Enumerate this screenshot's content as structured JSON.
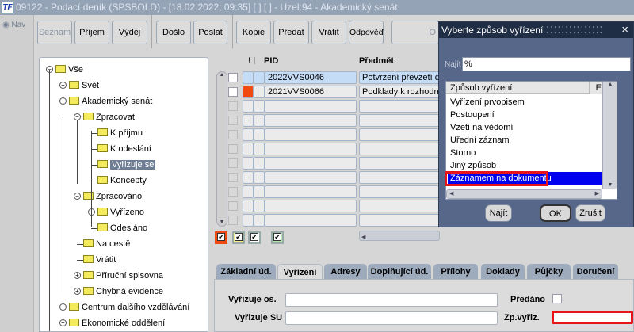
{
  "titlebar": {
    "logo": "TF",
    "title": "09122 - Podací deník (SPSBOLD) - [18.02.2022; 09:35]  [ ]  [ ] - Uzel:94 - Akademický senát"
  },
  "nav": {
    "label": "Nav"
  },
  "toolbar": {
    "buttons": [
      "Seznam",
      "Příjem",
      "Výdej",
      "Došlo",
      "Poslat",
      "Kopie",
      "Předat",
      "Vrátit",
      "Odpověď",
      "O"
    ]
  },
  "tree": [
    {
      "label": "Vše",
      "level": 0,
      "toggle": "-"
    },
    {
      "label": "Svět",
      "level": 1,
      "toggle": "+"
    },
    {
      "label": "Akademický senát",
      "level": 1,
      "toggle": "-"
    },
    {
      "label": "Zpracovat",
      "level": 2,
      "toggle": "-"
    },
    {
      "label": "K příjmu",
      "level": 3,
      "toggle": ""
    },
    {
      "label": "K odeslání",
      "level": 3,
      "toggle": ""
    },
    {
      "label": "Vyřizuje se",
      "level": 3,
      "toggle": "",
      "selected": true
    },
    {
      "label": "Koncepty",
      "level": 3,
      "toggle": ""
    },
    {
      "label": "Zpracováno",
      "level": 2,
      "toggle": "-"
    },
    {
      "label": "Vyřízeno",
      "level": 3,
      "toggle": "+"
    },
    {
      "label": "Odesláno",
      "level": 3,
      "toggle": ""
    },
    {
      "label": "Na cestě",
      "level": 2,
      "toggle": ""
    },
    {
      "label": "Vrátit",
      "level": 2,
      "toggle": ""
    },
    {
      "label": "Příruční spisovna",
      "level": 2,
      "toggle": "+"
    },
    {
      "label": "Chybná evidence",
      "level": 2,
      "toggle": "+"
    },
    {
      "label": "Centrum dalšího vzdělávání",
      "level": 1,
      "toggle": "+"
    },
    {
      "label": "Ekonomické oddělení",
      "level": 1,
      "toggle": "+"
    }
  ],
  "grid": {
    "headers": {
      "priority": "!",
      "attach_icon": "paperclip-icon",
      "pid": "PID",
      "subject": "Předmět"
    },
    "rows": [
      {
        "pid": "2022VVS0046",
        "subject": "Potvrzení převzetí dok",
        "flag": "",
        "selected": true
      },
      {
        "pid": "2021VVS0066",
        "subject": "Podklady k rozhodnut",
        "flag": "#f04a10"
      }
    ],
    "empty_rows": 9,
    "filters": [
      {
        "color": "#f04a10",
        "checked": true
      },
      {
        "color": "#f5ef8a",
        "checked": true
      },
      {
        "color": "#ffffff",
        "checked": true
      },
      {
        "color": "#b9e6b4",
        "checked": true
      }
    ]
  },
  "dialog": {
    "title": "Vyberte způsob vyřízení",
    "search_label": "Najít",
    "search_value": "%",
    "column": "Způsob vyřízení",
    "column2": "E",
    "items": [
      "Vyřízení prvopisem",
      "Postoupení",
      "Vzetí na vědomí",
      "Úřední záznam",
      "Storno",
      "Jiný způsob",
      "Záznamem na dokumentu"
    ],
    "selected_index": 6,
    "buttons": {
      "find": "Najít",
      "ok": "OK",
      "cancel": "Zrušit"
    },
    "close": "×"
  },
  "tabs": [
    "Základní úd.",
    "Vyřízení",
    "Adresy",
    "Doplňující úd.",
    "Přílohy",
    "Doklady",
    "Půjčky",
    "Doručení"
  ],
  "active_tab": 1,
  "form": {
    "vyrizuje_os": {
      "label": "Vyřizuje os.",
      "value": ""
    },
    "vyrizuje_su": {
      "label": "Vyřizuje SU",
      "value": ""
    },
    "predano": {
      "label": "Předáno",
      "checked": false
    },
    "zp_vyriz": {
      "label": "Zp.vyřiz.",
      "value": ""
    }
  }
}
